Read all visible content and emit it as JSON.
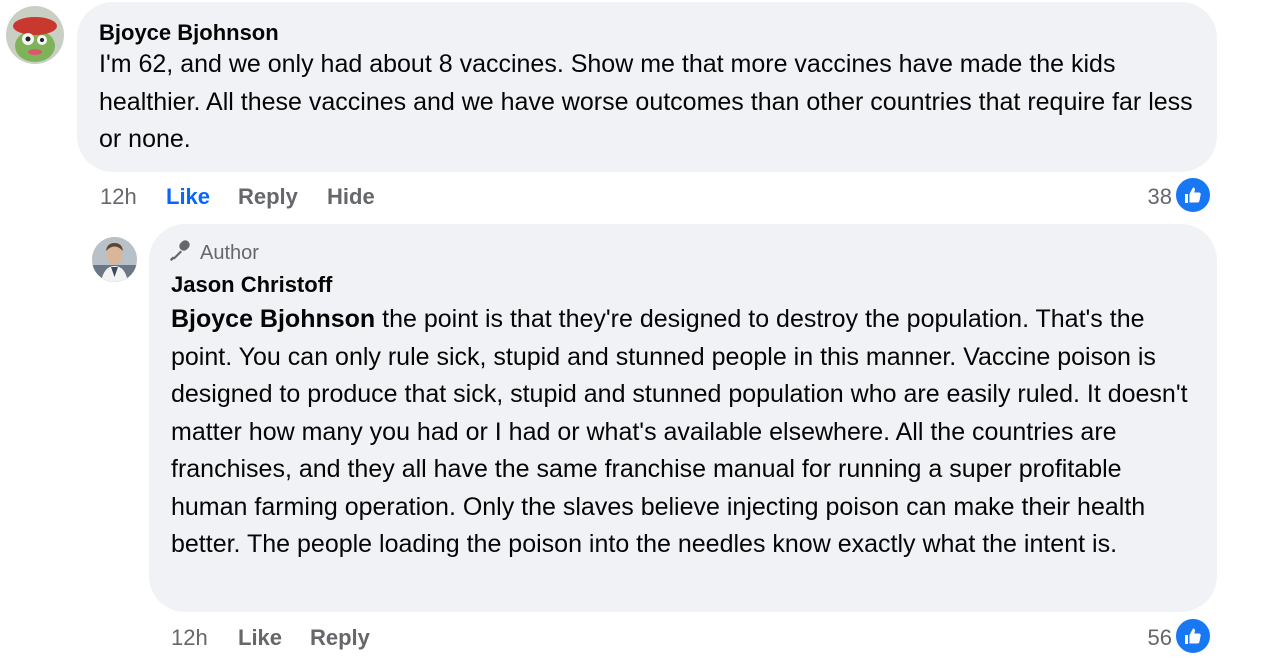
{
  "comments": [
    {
      "author": "Bjoyce Bjohnson",
      "text": "I'm 62, and we only had about 8 vaccines. Show me that more vaccines have made the kids healthier. All these vaccines and we have worse outcomes than other countries that require far less or none.",
      "time": "12h",
      "like_label": "Like",
      "reply_label": "Reply",
      "hide_label": "Hide",
      "reaction_count": "38",
      "like_active": true
    },
    {
      "badge": "Author",
      "author": "Jason Christoff",
      "mention": "Bjoyce Bjohnson",
      "text": " the point is that they're designed to destroy the population. That's the point. You can only rule sick, stupid and stunned people in this manner. Vaccine poison is designed to produce that sick, stupid and stunned population who are easily ruled. It doesn't matter how many you had or I had or what's available elsewhere. All the countries are franchises, and they all have the same franchise manual for running a super profitable human farming operation. Only the slaves believe injecting poison can make their health better. The people loading the poison into the needles know exactly what the intent is.",
      "time": "12h",
      "like_label": "Like",
      "reply_label": "Reply",
      "reaction_count": "56"
    }
  ],
  "icons": {
    "like_badge": "thumbs-up-icon",
    "author_badge": "microphone-icon"
  },
  "colors": {
    "bubble": "#f0f2f5",
    "like_active": "#0866ff",
    "reaction_blue": "#1877f2",
    "meta_gray": "#65676b"
  }
}
